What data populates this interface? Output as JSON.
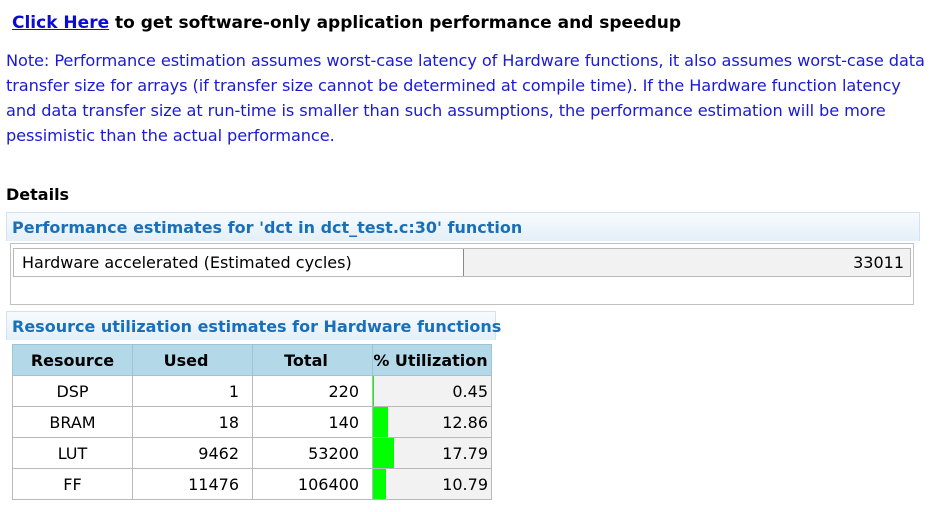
{
  "header": {
    "link_text": "Click Here",
    "rest_text": " to get software-only application performance and speedup"
  },
  "note": "Note: Performance estimation assumes worst-case latency of Hardware functions, it also assumes worst-case data transfer size for arrays (if transfer size cannot be determined at compile time). If the Hardware function latency and data transfer size at run-time is smaller than such assumptions, the performance estimation will be more pessimistic than the actual performance.",
  "details_heading": "Details",
  "performance": {
    "title": "Performance estimates for 'dct in dct_test.c:30' function",
    "label": "Hardware accelerated (Estimated cycles)",
    "value": "33011"
  },
  "resources": {
    "title": "Resource utilization estimates for Hardware functions",
    "columns": [
      "Resource",
      "Used",
      "Total",
      "% Utilization"
    ],
    "rows": [
      {
        "resource": "DSP",
        "used": "1",
        "total": "220",
        "util": "0.45",
        "fraction": 0.0045
      },
      {
        "resource": "BRAM",
        "used": "18",
        "total": "140",
        "util": "12.86",
        "fraction": 0.1286
      },
      {
        "resource": "LUT",
        "used": "9462",
        "total": "53200",
        "util": "17.79",
        "fraction": 0.1779
      },
      {
        "resource": "FF",
        "used": "11476",
        "total": "106400",
        "util": "10.79",
        "fraction": 0.1079
      }
    ],
    "bar_color": "#00ff00"
  }
}
